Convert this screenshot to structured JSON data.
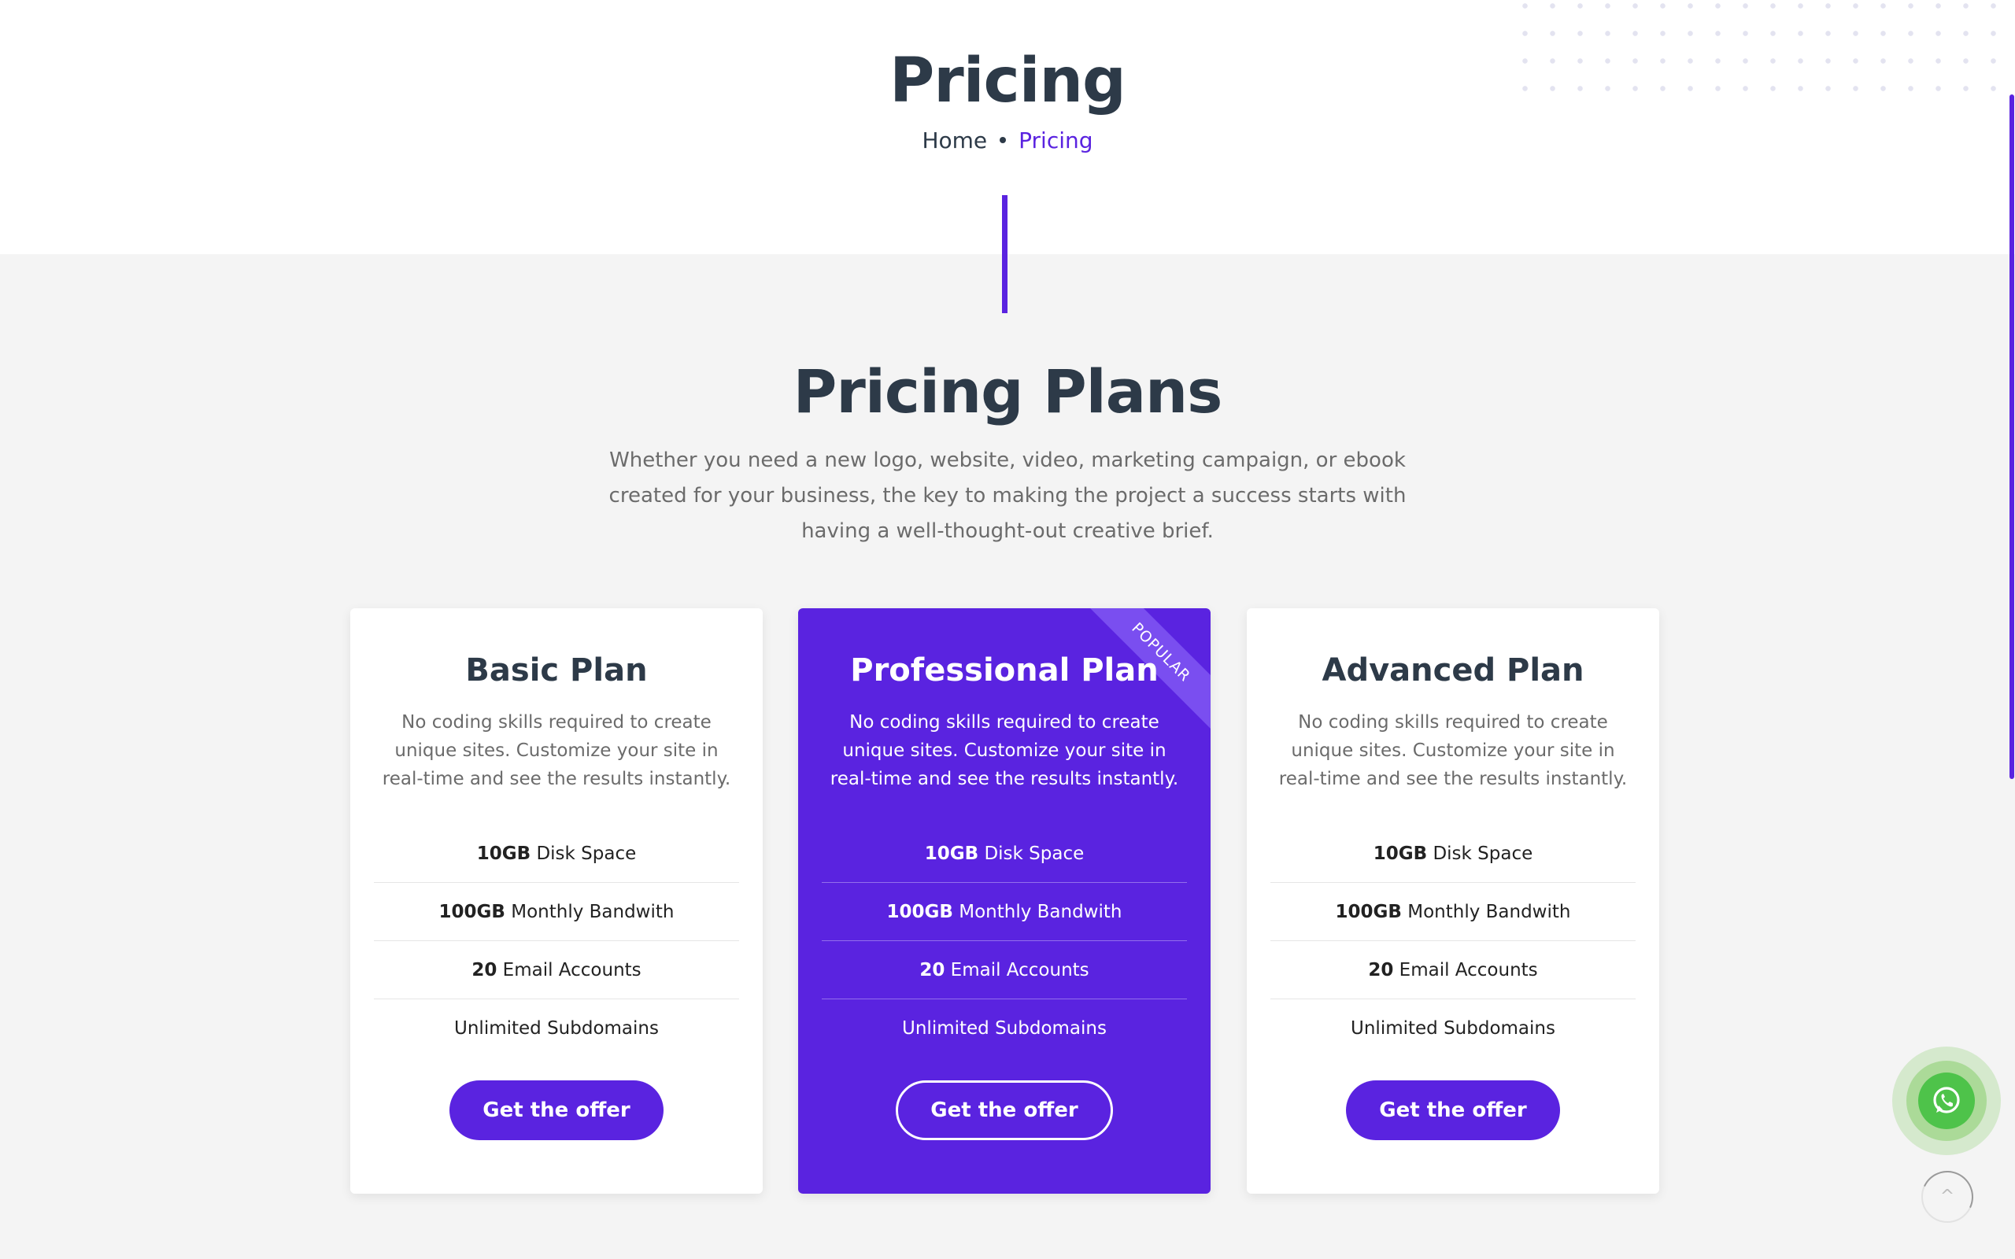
{
  "header": {
    "title": "Pricing",
    "breadcrumb": {
      "home": "Home",
      "current": "Pricing"
    }
  },
  "section": {
    "title": "Pricing Plans",
    "description": "Whether you need a new logo, website, video, marketing campaign, or ebook created for your business, the key to making the project a success starts with having a well-thought-out creative brief."
  },
  "plans": [
    {
      "name": "Basic Plan",
      "description": "No coding skills required to create unique sites. Customize your site in real-time and see the results instantly.",
      "features": [
        {
          "bold": "10GB",
          "text": " Disk Space"
        },
        {
          "bold": "100GB",
          "text": " Monthly Bandwith"
        },
        {
          "bold": "20",
          "text": " Email Accounts"
        },
        {
          "bold": "",
          "text": "Unlimited Subdomains"
        }
      ],
      "button": "Get the offer"
    },
    {
      "name": "Professional Plan",
      "badge": "POPULAR",
      "description": "No coding skills required to create unique sites. Customize your site in real-time and see the results instantly.",
      "features": [
        {
          "bold": "10GB",
          "text": " Disk Space"
        },
        {
          "bold": "100GB",
          "text": " Monthly Bandwith"
        },
        {
          "bold": "20",
          "text": " Email Accounts"
        },
        {
          "bold": "",
          "text": "Unlimited Subdomains"
        }
      ],
      "button": "Get the offer"
    },
    {
      "name": "Advanced Plan",
      "description": "No coding skills required to create unique sites. Customize your site in real-time and see the results instantly.",
      "features": [
        {
          "bold": "10GB",
          "text": " Disk Space"
        },
        {
          "bold": "100GB",
          "text": " Monthly Bandwith"
        },
        {
          "bold": "20",
          "text": " Email Accounts"
        },
        {
          "bold": "",
          "text": "Unlimited Subdomains"
        }
      ],
      "button": "Get the offer"
    }
  ],
  "floating": {
    "whatsapp_icon": "whatsapp-icon",
    "back_to_top_label": "^"
  },
  "colors": {
    "accent": "#5a23e0",
    "heading": "#2d3a48",
    "whatsapp": "#4ec34a"
  }
}
